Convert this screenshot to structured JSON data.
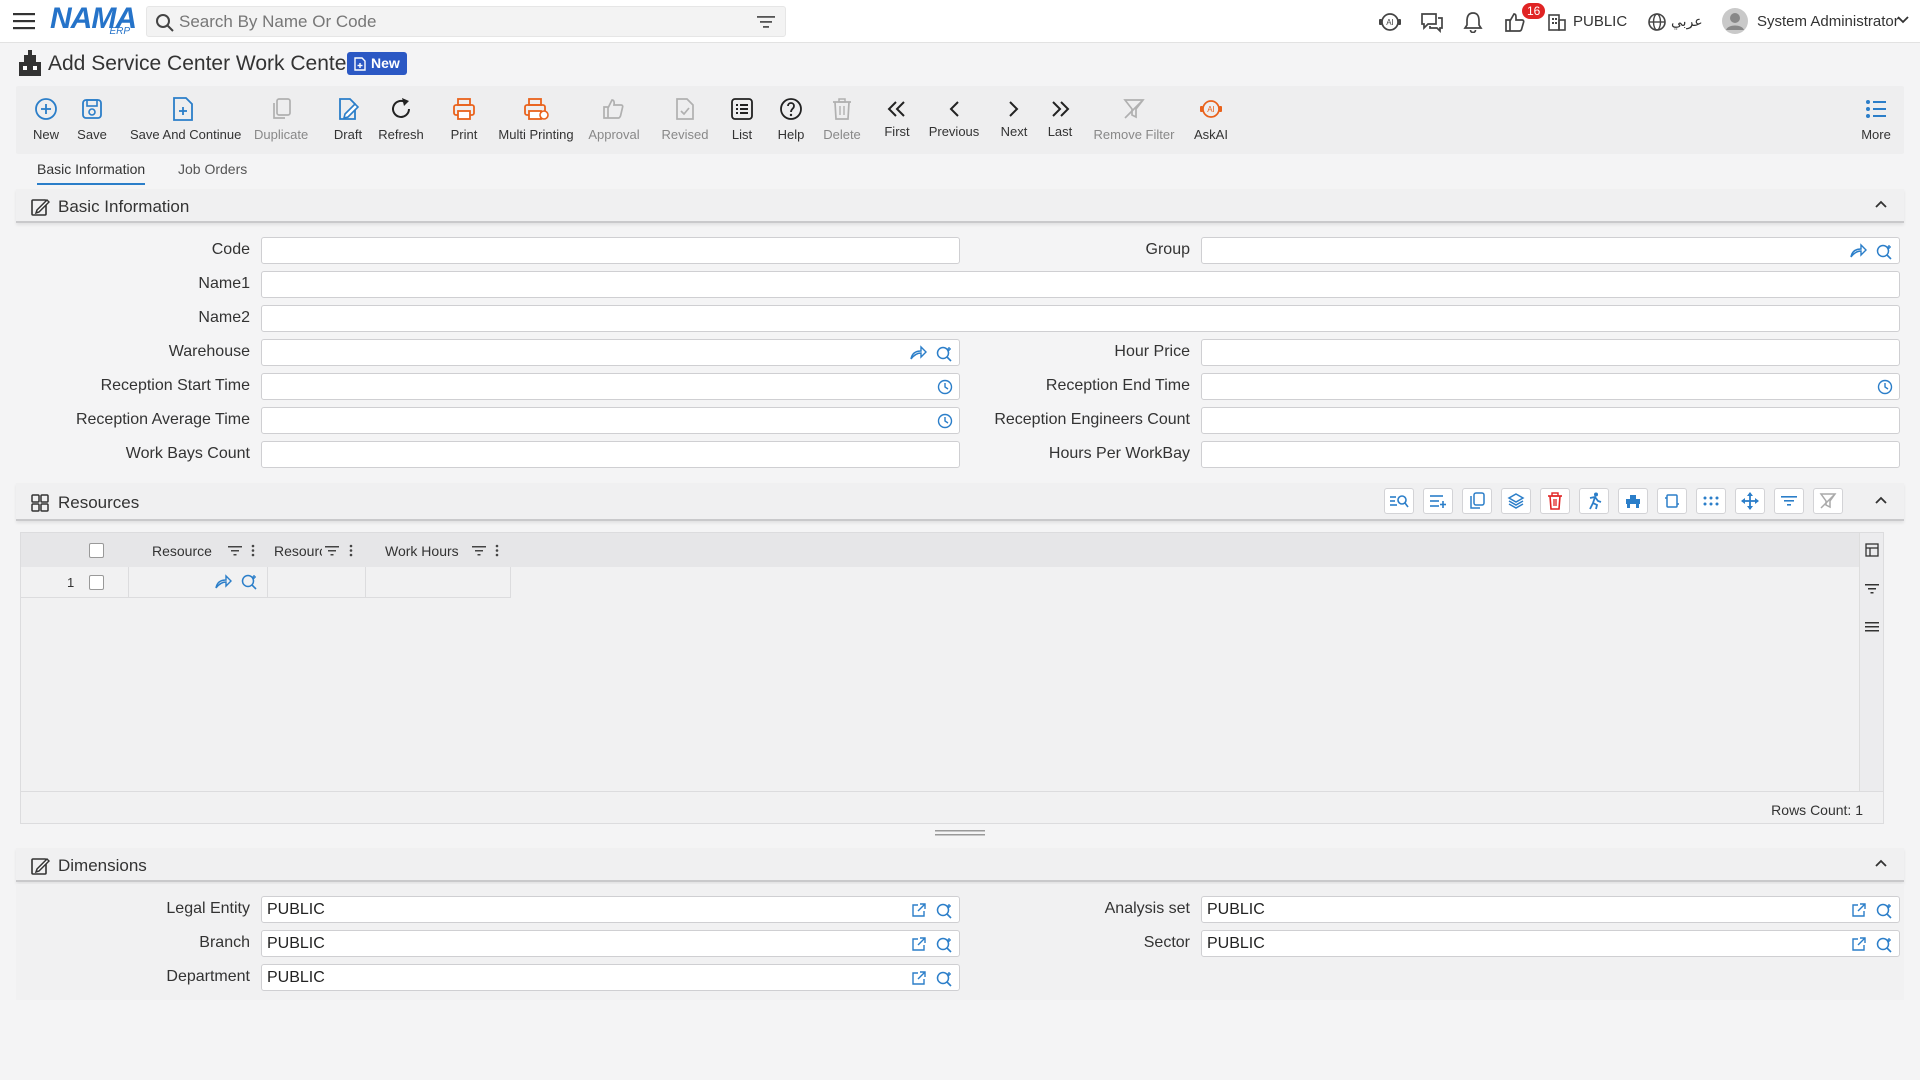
{
  "topbar": {
    "logo_main": "NAMA",
    "logo_sub": "ERP",
    "search_placeholder": "Search By Name Or Code",
    "notification_count": "16",
    "legal_entity": "PUBLIC",
    "language": "عربي",
    "user_name": "System Administrator"
  },
  "page": {
    "title": "Add Service Center Work Center",
    "status_badge": "New"
  },
  "toolbar": [
    {
      "label": "New",
      "icon": "plus-circle-icon",
      "color": "#2b7ec9"
    },
    {
      "label": "Save",
      "icon": "save-icon",
      "color": "#2b7ec9"
    },
    {
      "label": "Save And Continue",
      "icon": "file-plus-icon",
      "color": "#2b7ec9"
    },
    {
      "label": "Duplicate",
      "icon": "copy-icon",
      "color": "#b0b0b0"
    },
    {
      "label": "Draft",
      "icon": "draft-icon",
      "color": "#2b7ec9"
    },
    {
      "label": "Refresh",
      "icon": "refresh-icon",
      "color": "#222222"
    },
    {
      "label": "Print",
      "icon": "printer-icon",
      "color": "#e9621c"
    },
    {
      "label": "Multi Printing",
      "icon": "multi-printer-icon",
      "color": "#e9621c"
    },
    {
      "label": "Approval",
      "icon": "thumbs-up-icon",
      "color": "#b0b0b0"
    },
    {
      "label": "Revised",
      "icon": "revised-icon",
      "color": "#b0b0b0"
    },
    {
      "label": "List",
      "icon": "list-icon",
      "color": "#222222"
    },
    {
      "label": "Help",
      "icon": "help-icon",
      "color": "#222222"
    },
    {
      "label": "Delete",
      "icon": "trash-icon",
      "color": "#b0b0b0"
    },
    {
      "label": "First",
      "icon": "first-icon",
      "color": "#222222"
    },
    {
      "label": "Previous",
      "icon": "previous-icon",
      "color": "#222222"
    },
    {
      "label": "Next",
      "icon": "next-icon",
      "color": "#222222"
    },
    {
      "label": "Last",
      "icon": "last-icon",
      "color": "#222222"
    },
    {
      "label": "Remove Filter",
      "icon": "remove-filter-icon",
      "color": "#b0b0b0"
    },
    {
      "label": "AskAI",
      "icon": "ai-icon",
      "color": "#e9621c"
    },
    {
      "label": "More",
      "icon": "more-icon",
      "color": "#2b7ec9"
    }
  ],
  "tabs": [
    "Basic Information",
    "Job Orders"
  ],
  "basic": {
    "title": "Basic Information",
    "labels": {
      "code": "Code",
      "group": "Group",
      "name1": "Name1",
      "name2": "Name2",
      "warehouse": "Warehouse",
      "hour_price": "Hour Price",
      "reception_start": "Reception Start Time",
      "reception_end": "Reception End Time",
      "reception_avg": "Reception Average Time",
      "reception_engineers": "Reception Engineers Count",
      "work_bays": "Work Bays Count",
      "hours_per_workbay": "Hours Per WorkBay"
    }
  },
  "resources": {
    "title": "Resources",
    "columns": [
      "Resource",
      "Resourc",
      "Work Hours"
    ],
    "row_number": "1",
    "rows_count_label": "Rows Count: 1"
  },
  "dimensions": {
    "title": "Dimensions",
    "labels": {
      "legal_entity": "Legal Entity",
      "analysis_set": "Analysis set",
      "branch": "Branch",
      "sector": "Sector",
      "department": "Department"
    },
    "values": {
      "legal_entity": "PUBLIC",
      "analysis_set": "PUBLIC",
      "branch": "PUBLIC",
      "sector": "PUBLIC",
      "department": "PUBLIC"
    }
  }
}
